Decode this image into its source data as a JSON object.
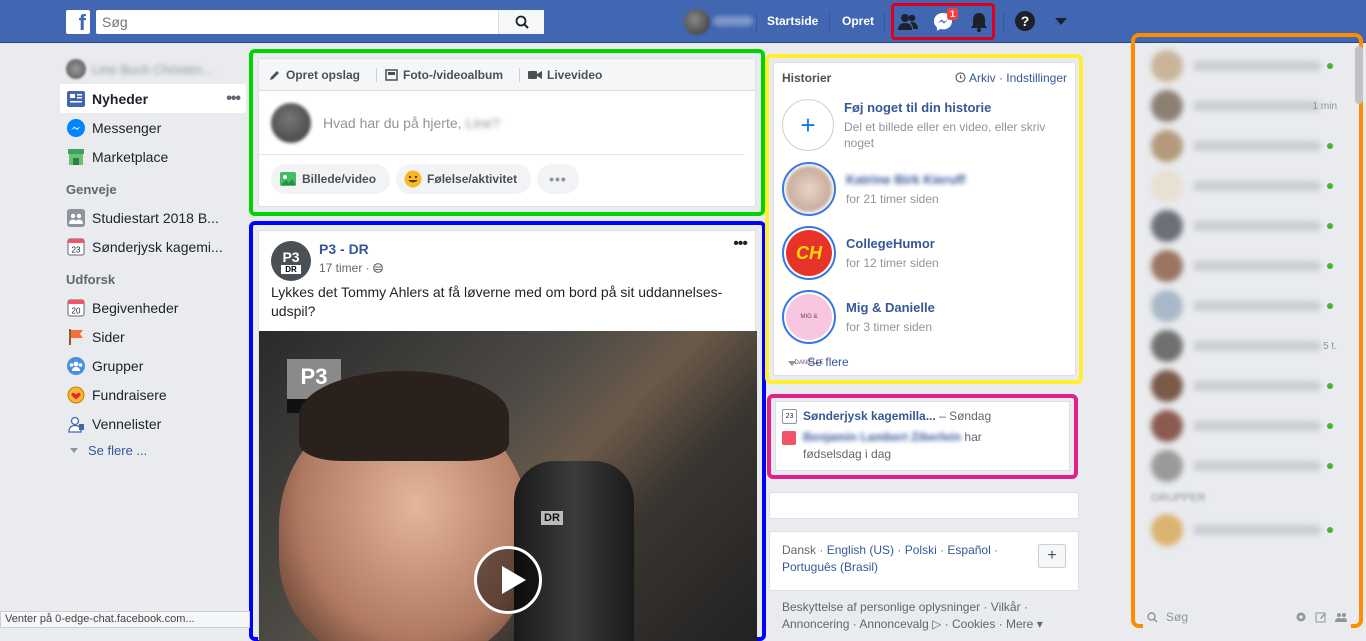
{
  "topbar": {
    "logo": "f",
    "search_placeholder": "Søg",
    "links": [
      "Startside",
      "Opret"
    ],
    "messenger_badge": "1",
    "help": "?"
  },
  "left_nav": {
    "profile_name": "Line Buch Christen...",
    "items": [
      {
        "label": "Nyheder",
        "icon": "news-feed-icon"
      },
      {
        "label": "Messenger",
        "icon": "messenger-icon"
      },
      {
        "label": "Marketplace",
        "icon": "marketplace-icon"
      }
    ],
    "shortcuts_title": "Genveje",
    "shortcuts": [
      {
        "label": "Studiestart 2018 B...",
        "icon": "group-icon"
      },
      {
        "label": "Sønderjysk kagemi...",
        "icon": "calendar-icon"
      }
    ],
    "explore_title": "Udforsk",
    "explore": [
      {
        "label": "Begivenheder",
        "icon": "calendar-icon"
      },
      {
        "label": "Sider",
        "icon": "flag-icon"
      },
      {
        "label": "Grupper",
        "icon": "groups-icon"
      },
      {
        "label": "Fundraisere",
        "icon": "fundraiser-icon"
      },
      {
        "label": "Vennelister",
        "icon": "friend-list-icon"
      }
    ],
    "see_more": "Se flere ..."
  },
  "composer": {
    "tabs": [
      "Opret opslag",
      "Foto-/videoalbum",
      "Livevideo"
    ],
    "placeholder": "Hvad har du på hjerte,",
    "placeholder_name": "Line?",
    "buttons": [
      "Billede/video",
      "Følelse/aktivitet"
    ]
  },
  "post": {
    "author": "P3 - DR",
    "logo_top": "P3",
    "logo_bottom": "DR",
    "time": "17 timer ·",
    "text": "Lykkes det Tommy Ahlers at få løverne med om bord på sit uddannelses-udspil?",
    "video_logo_top": "P3",
    "video_logo_bottom": "DR",
    "mic_label": "DR"
  },
  "stories": {
    "title": "Historier",
    "archive": "Arkiv",
    "settings": "Indstillinger",
    "add_title": "Føj noget til din historie",
    "add_sub": "Del et billede eller en video, eller skriv noget",
    "items": [
      {
        "name": "Katrine Birk Kieruff",
        "time": "for 21 timer siden"
      },
      {
        "name": "CollegeHumor",
        "time": "for 12 timer siden"
      },
      {
        "name": "Mig & Danielle",
        "time": "for 3 timer siden"
      }
    ],
    "see_more": "Se flere"
  },
  "events": {
    "event_icon_text": "23",
    "event_name": "Sønderjysk kagemilla...",
    "event_day": "– Søndag",
    "birthday_name": "Benjamin Lambert Ziberlein",
    "birthday_text": "har",
    "birthday_text2": "fødselsdag i dag"
  },
  "languages": {
    "items": [
      "Dansk",
      "English (US)",
      "Polski",
      "Español",
      "Português (Brasil)"
    ],
    "add": "+"
  },
  "footer": {
    "line1": "Beskyttelse af personlige oplysninger · Vilkår ·",
    "line2": "Annoncering · Annoncevalg ▷ · Cookies · Mere ▾"
  },
  "chat": {
    "contacts": [
      {
        "meta": ""
      },
      {
        "meta": "1 min"
      },
      {
        "meta": ""
      },
      {
        "meta": ""
      },
      {
        "meta": ""
      },
      {
        "meta": ""
      },
      {
        "meta": ""
      },
      {
        "meta": "5 t."
      },
      {
        "meta": ""
      },
      {
        "meta": ""
      },
      {
        "meta": ""
      },
      {
        "meta": ""
      }
    ],
    "section": "GRUPPER",
    "group_sub": "Camilla, Camilla",
    "search_placeholder": "Søg"
  },
  "statusbar": "Venter på 0-edge-chat.facebook.com..."
}
